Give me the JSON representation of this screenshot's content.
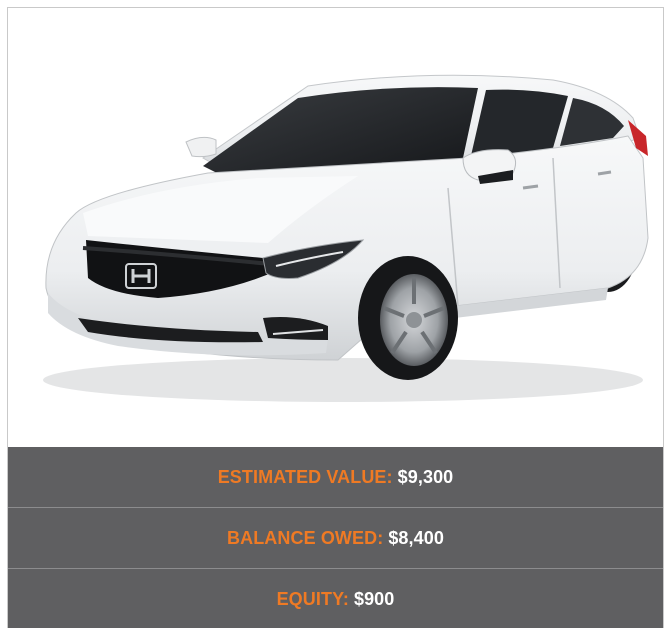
{
  "vehicle": {
    "image_alt": "white sedan",
    "brand_icon": "honda-logo-icon"
  },
  "summary": {
    "rows": [
      {
        "label": "ESTIMATED VALUE:",
        "value": "$9,300"
      },
      {
        "label": "BALANCE OWED:",
        "value": "$8,400"
      },
      {
        "label": "EQUITY:",
        "value": "$900"
      }
    ]
  },
  "colors": {
    "accent": "#ef7a24",
    "panel": "#5f5f61",
    "value_text": "#ffffff"
  }
}
